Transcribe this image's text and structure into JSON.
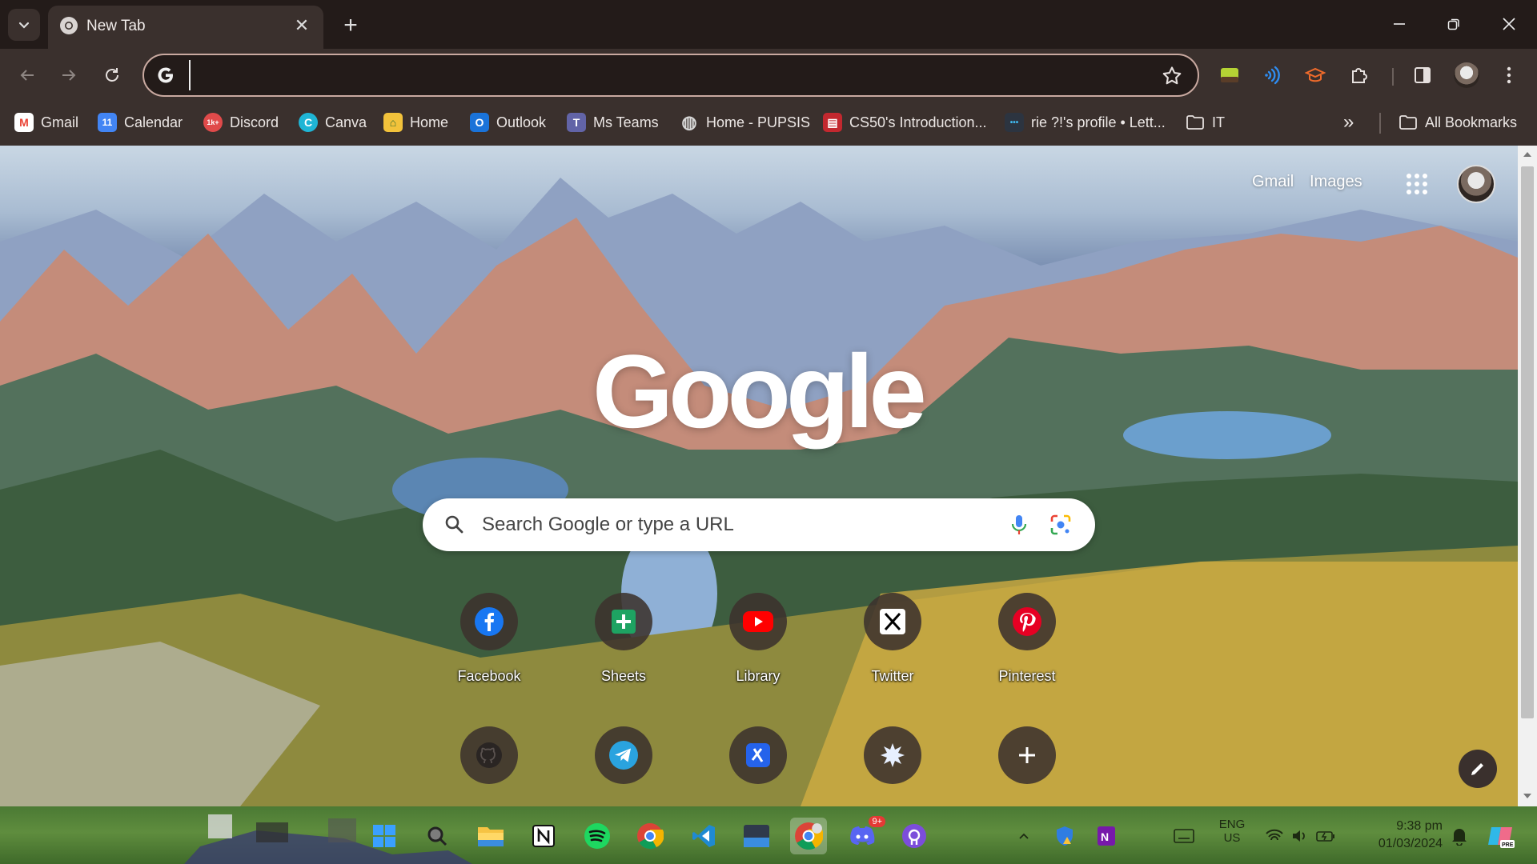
{
  "tab": {
    "title": "New Tab",
    "close_glyph": "✕",
    "new_tab_glyph": "+"
  },
  "omnibox": {
    "value": "",
    "placeholder": ""
  },
  "bookmarks": [
    {
      "label": "Gmail",
      "icon": "gmail-icon",
      "color": "#ea4335",
      "glyph": "M"
    },
    {
      "label": "Calendar",
      "icon": "calendar-icon",
      "color": "#4285f4",
      "glyph": "11"
    },
    {
      "label": "Discord",
      "icon": "discord-icon",
      "color": "#e04a4a",
      "glyph": "1k+"
    },
    {
      "label": "Canva",
      "icon": "canva-icon",
      "color": "#1fb5d5",
      "glyph": "C"
    },
    {
      "label": "Home",
      "icon": "home-icon",
      "color": "#f2c23b",
      "glyph": "⌂"
    },
    {
      "label": "Outlook",
      "icon": "outlook-icon",
      "color": "#1a73d9",
      "glyph": "O"
    },
    {
      "label": "Ms Teams",
      "icon": "teams-icon",
      "color": "#6264a7",
      "glyph": "T"
    },
    {
      "label": "Home - PUPSIS",
      "icon": "globe-icon",
      "color": "#cfcfcf",
      "glyph": "◍"
    },
    {
      "label": "CS50's Introduction...",
      "icon": "cs50-icon",
      "color": "#c3282f",
      "glyph": "▤"
    },
    {
      "label": "rie ?!'s profile • Lett...",
      "icon": "letterboxd-icon",
      "color": "#2c3440",
      "glyph": "•••"
    },
    {
      "label": "IT",
      "icon": "folder-icon",
      "color": "transparent",
      "glyph": ""
    }
  ],
  "bookmarks_overflow": "»",
  "all_bookmarks": "All Bookmarks",
  "ntp": {
    "gmail_link": "Gmail",
    "images_link": "Images",
    "logo": "Google",
    "search_placeholder": "Search Google or type a URL",
    "shortcuts_row1": [
      {
        "label": "Facebook",
        "icon": "facebook-icon"
      },
      {
        "label": "Sheets",
        "icon": "sheets-icon"
      },
      {
        "label": "Library",
        "icon": "youtube-icon"
      },
      {
        "label": "Twitter",
        "icon": "x-icon"
      },
      {
        "label": "Pinterest",
        "icon": "pinterest-icon"
      }
    ],
    "shortcuts_row2": [
      {
        "label": "",
        "icon": "github-icon"
      },
      {
        "label": "",
        "icon": "telegram-icon"
      },
      {
        "label": "",
        "icon": "app-icon"
      },
      {
        "label": "",
        "icon": "burst-icon"
      },
      {
        "label": "",
        "icon": "add-shortcut-icon"
      }
    ]
  },
  "taskbar": {
    "lang_top": "ENG",
    "lang_bottom": "US",
    "time": "9:38 pm",
    "date": "01/03/2024",
    "discord_badge": "9+"
  }
}
